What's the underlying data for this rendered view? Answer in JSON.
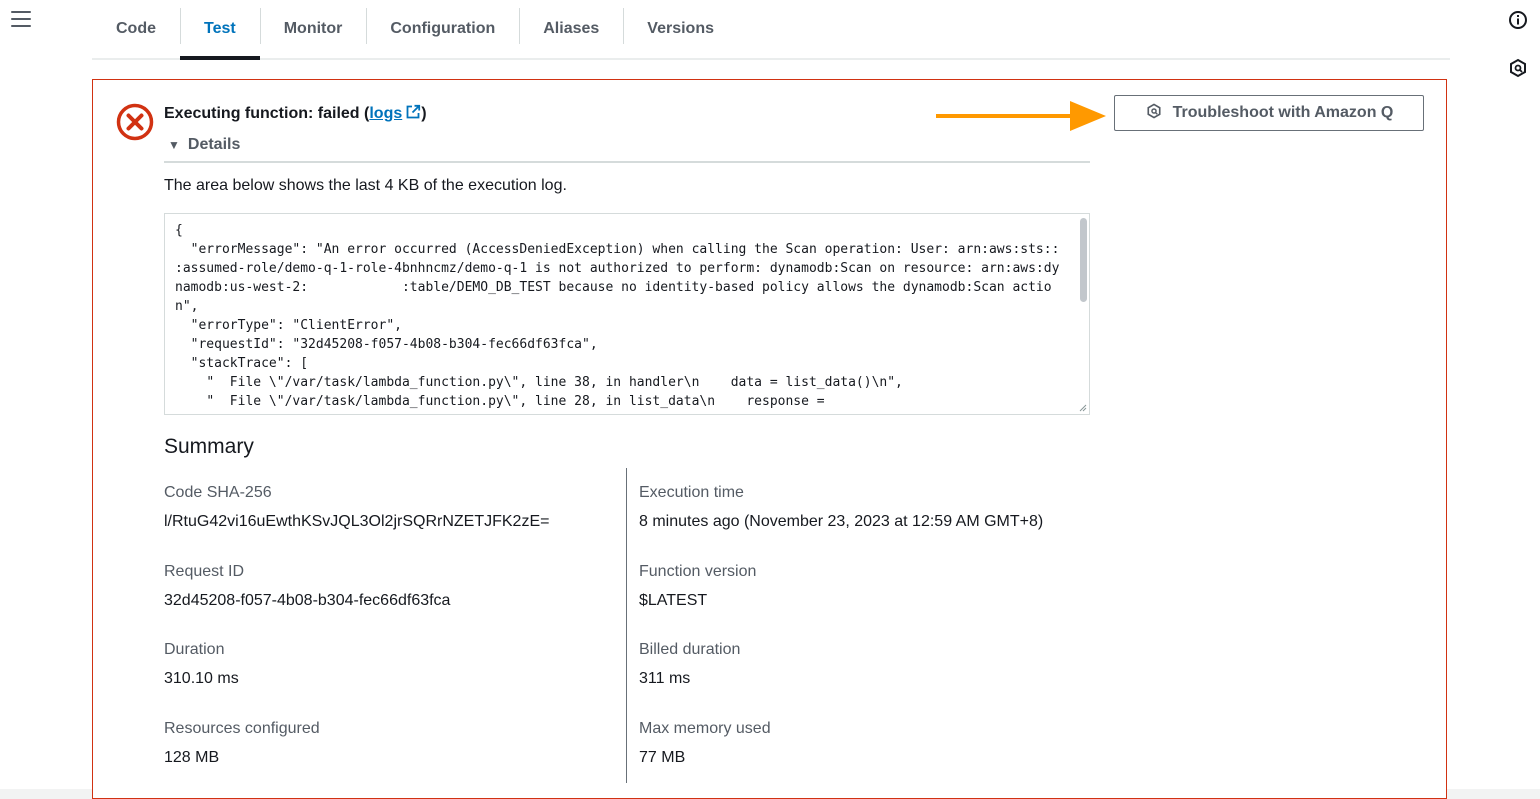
{
  "tabs": [
    {
      "label": "Code",
      "active": false
    },
    {
      "label": "Test",
      "active": true
    },
    {
      "label": "Monitor",
      "active": false
    },
    {
      "label": "Configuration",
      "active": false
    },
    {
      "label": "Aliases",
      "active": false
    },
    {
      "label": "Versions",
      "active": false
    }
  ],
  "result": {
    "status_text": "Executing function: failed (",
    "logs_label": "logs",
    "status_close": ")",
    "details_label": "Details",
    "troubleshoot_label": "Troubleshoot with Amazon Q",
    "log_caption": "The area below shows the last 4 KB of the execution log.",
    "log_text": "{\n  \"errorMessage\": \"An error occurred (AccessDeniedException) when calling the Scan operation: User: arn:aws:sts::            :assumed-role/demo-q-1-role-4bnhncmz/demo-q-1 is not authorized to perform: dynamodb:Scan on resource: arn:aws:dynamodb:us-west-2:            :table/DEMO_DB_TEST because no identity-based policy allows the dynamodb:Scan action\",\n  \"errorType\": \"ClientError\",\n  \"requestId\": \"32d45208-f057-4b08-b304-fec66df63fca\",\n  \"stackTrace\": [\n    \"  File \\\"/var/task/lambda_function.py\\\", line 38, in handler\\n    data = list_data()\\n\",\n    \"  File \\\"/var/task/lambda_function.py\\\", line 28, in list_data\\n    response =",
    "status_color": "#d13212",
    "accent_color": "#ff9900"
  },
  "summary": {
    "title": "Summary",
    "left": [
      {
        "label": "Code SHA-256",
        "value": "l/RtuG42vi16uEwthKSvJQL3Ol2jrSQRrNZETJFK2zE="
      },
      {
        "label": "Request ID",
        "value": "32d45208-f057-4b08-b304-fec66df63fca"
      },
      {
        "label": "Duration",
        "value": "310.10 ms"
      },
      {
        "label": "Resources configured",
        "value": "128 MB"
      }
    ],
    "right": [
      {
        "label": "Execution time",
        "value": "8 minutes ago (November 23, 2023 at 12:59 AM GMT+8)"
      },
      {
        "label": "Function version",
        "value": "$LATEST"
      },
      {
        "label": "Billed duration",
        "value": "311 ms"
      },
      {
        "label": "Max memory used",
        "value": "77 MB"
      }
    ]
  },
  "icons": {
    "menu": "hamburger-menu-icon",
    "info": "info-icon",
    "amazon_q": "amazon-q-icon",
    "failed": "error-circle-icon",
    "external": "external-link-icon"
  }
}
